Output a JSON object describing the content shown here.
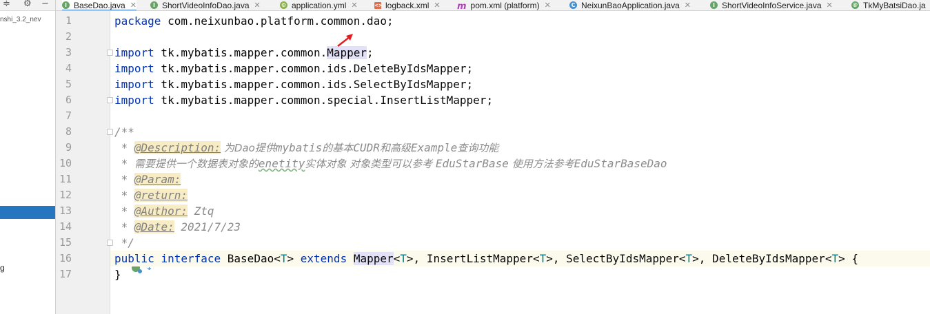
{
  "project_panel": {
    "project_fragment": "nshi_3.2_nev",
    "bottom_fragment": "g",
    "toolbar_icons": [
      "collapse-icon",
      "gear-icon",
      "minimize-icon"
    ]
  },
  "tabs": [
    {
      "label": "BaseDao.java",
      "icon": "interface-icon",
      "active": true
    },
    {
      "label": "ShortVideoInfoDao.java",
      "icon": "interface-icon",
      "active": false
    },
    {
      "label": "application.yml",
      "icon": "yaml-icon",
      "active": false
    },
    {
      "label": "logback.xml",
      "icon": "xml-icon",
      "active": false
    },
    {
      "label": "pom.xml (platform)",
      "icon": "maven-icon",
      "active": false
    },
    {
      "label": "NeixunBaoApplication.java",
      "icon": "class-icon",
      "active": false
    },
    {
      "label": "ShortVideoInfoService.java",
      "icon": "interface-icon",
      "active": false
    },
    {
      "label": "TkMyBatsiDao.ja",
      "icon": "annotation-icon",
      "active": false
    }
  ],
  "line_numbers": [
    "1",
    "2",
    "3",
    "4",
    "5",
    "6",
    "7",
    "8",
    "9",
    "10",
    "11",
    "12",
    "13",
    "14",
    "15",
    "16",
    "17"
  ],
  "code": {
    "l1_kw": "package",
    "l1_rest": " com.neixunbao.platform.common.dao;",
    "imp_kw": "import",
    "l3_pre": " tk.mybatis.mapper.common.",
    "l3_hl": "Mapper",
    "l3_post": ";",
    "l4_rest": " tk.mybatis.mapper.common.ids.DeleteByIdsMapper;",
    "l5_rest": " tk.mybatis.mapper.common.ids.SelectByIdsMapper;",
    "l6_rest": " tk.mybatis.mapper.common.special.InsertListMapper;",
    "l8": "/**",
    "star": " * ",
    "l9_tag": "@Description:",
    "l9_pre": " 为Dao提供",
    "l9_a": "mybatis",
    "l9_b": "的基本",
    "l9_c": "CUDR",
    "l9_d": "和高级",
    "l9_e": "Example",
    "l9_f": "查询功能",
    "l10_a": "需要提供一个数据表对象的",
    "l10_b": "enetity",
    "l10_c": "实体对象 对象类型可以参考 ",
    "l10_d": "EduStarBase",
    "l10_e": " 使用方法参考",
    "l10_f": "EduStarBaseDao",
    "l11_tag": "@Param:",
    "l12_tag": "@return:",
    "l13_tag": "@Author:",
    "l13_val": " Ztq",
    "l14_tag": "@Date:",
    "l14_val": " 2021/7/23",
    "l15": " */",
    "l16_kw1": "public",
    "l16_kw2": "interface",
    "l16_name": "BaseDao<",
    "T": "T",
    "gt": ">",
    "l16_kw3": "extends",
    "mapper": "Mapper",
    "lt": "<",
    "comma_insert": ">, InsertListMapper<",
    "comma_select": ">, SelectByIdsMapper<",
    "comma_delete": ">, DeleteByIdsMapper<",
    "l16_end": "> {",
    "l17": "}"
  }
}
